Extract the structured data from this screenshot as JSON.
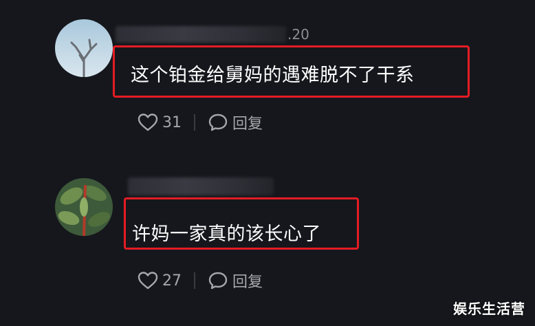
{
  "comments": [
    {
      "username_suffix": ".20",
      "text": "这个铂金给舅妈的遇难脱不了干系",
      "likes": "31",
      "reply_label": "回复"
    },
    {
      "text": "许妈一家真的该长心了",
      "likes": "27",
      "reply_label": "回复"
    }
  ],
  "watermark": "娱乐生活营",
  "colors": {
    "background": "#16171d",
    "highlight_border": "#e51c23",
    "meta_text": "#8b8c93",
    "action_text": "#a6a7ad"
  },
  "icons": {
    "like": "heart-outline-icon",
    "reply": "speech-bubble-icon"
  }
}
